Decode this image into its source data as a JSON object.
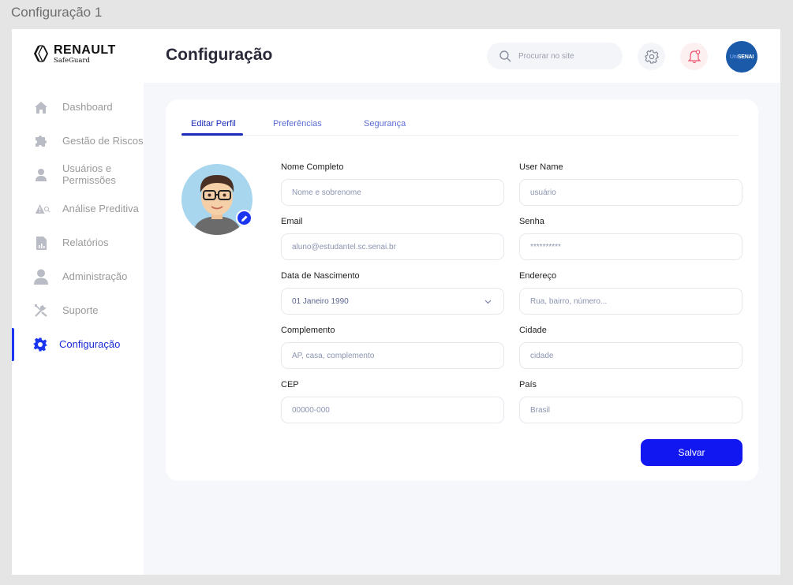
{
  "frame": {
    "title": "Configuração 1"
  },
  "brand": {
    "name": "RENAULT",
    "subtitle": "SafeGuard"
  },
  "sidebar": {
    "items": [
      {
        "label": "Dashboard",
        "icon": "home-icon"
      },
      {
        "label": "Gestão de Riscos",
        "icon": "puzzle-icon"
      },
      {
        "label": "Usuários e Permissões",
        "icon": "user-icon"
      },
      {
        "label": "Análise Preditiva",
        "icon": "warning-search-icon"
      },
      {
        "label": "Relatórios",
        "icon": "report-icon"
      },
      {
        "label": "Administração",
        "icon": "admin-icon"
      },
      {
        "label": "Suporte",
        "icon": "tools-icon"
      },
      {
        "label": "Configuração",
        "icon": "gear-icon",
        "active": true
      }
    ]
  },
  "header": {
    "title": "Configuração",
    "search_placeholder": "Procurar no site",
    "avatar_text_uni": "Uni",
    "avatar_text_senai": "SENAI"
  },
  "tabs": [
    {
      "label": "Editar Perfil",
      "active": true
    },
    {
      "label": "Preferências"
    },
    {
      "label": "Segurança"
    }
  ],
  "form": {
    "nome_completo": {
      "label": "Nome Completo",
      "placeholder": "Nome e sobrenome"
    },
    "user_name": {
      "label": "User Name",
      "placeholder": "usuário"
    },
    "email": {
      "label": "Email",
      "placeholder": "aluno@estudantel.sc.senai.br"
    },
    "senha": {
      "label": "Senha",
      "placeholder": "**********"
    },
    "data_nascimento": {
      "label": "Data de Nascimento",
      "value": "01 Janeiro 1990"
    },
    "endereco": {
      "label": "Endereço",
      "placeholder": "Rua, bairro, número..."
    },
    "complemento": {
      "label": "Complemento",
      "placeholder": "AP, casa, complemento"
    },
    "cidade": {
      "label": "Cidade",
      "placeholder": "cidade"
    },
    "cep": {
      "label": "CEP",
      "placeholder": "00000-000"
    },
    "pais": {
      "label": "País",
      "placeholder": "Brasil"
    },
    "save_label": "Salvar"
  },
  "colors": {
    "accent": "#1a36f0",
    "sidebar_bg": "#ffffff",
    "page_bg": "#f5f7fa",
    "bell": "#f0506e"
  }
}
